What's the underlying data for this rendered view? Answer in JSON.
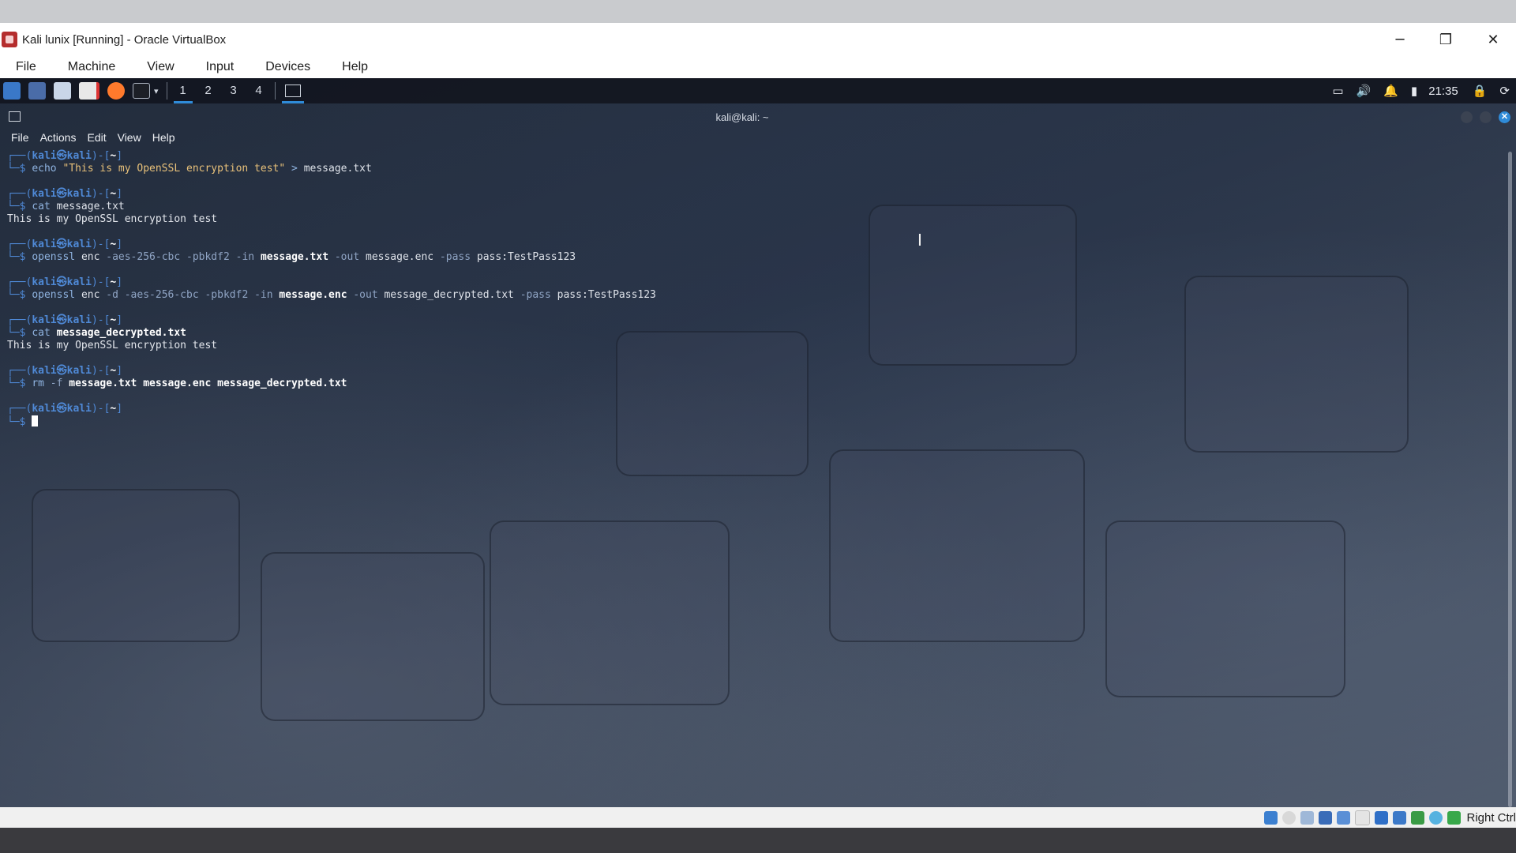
{
  "vbox": {
    "title": "Kali lunix [Running] - Oracle VirtualBox",
    "menu": [
      "File",
      "Machine",
      "View",
      "Input",
      "Devices",
      "Help"
    ],
    "controls": {
      "minimize": "─",
      "restore": "❐",
      "close": "✕"
    },
    "host_key": "Right Ctrl"
  },
  "panel": {
    "workspaces": [
      "1",
      "2",
      "3",
      "4"
    ],
    "active_workspace": "1",
    "clock": "21:35"
  },
  "terminal": {
    "title": "kali@kali: ~",
    "menu": [
      "File",
      "Actions",
      "Edit",
      "View",
      "Help"
    ],
    "prompt": {
      "top_prefix": "┌──(",
      "user": "kali㉿kali",
      "mid": ")-[",
      "dir": "~",
      "end": "]",
      "bottom": "└─$"
    },
    "blocks": [
      {
        "tokens": [
          {
            "t": "echo",
            "c": "cmd"
          },
          {
            "t": "\"This is my OpenSSL encryption test\"",
            "c": "str"
          },
          {
            "t": ">",
            "c": "cmd"
          },
          {
            "t": "message.txt",
            "c": "arg"
          }
        ],
        "output": []
      },
      {
        "tokens": [
          {
            "t": "cat",
            "c": "cmd"
          },
          {
            "t": "message.txt",
            "c": "arg"
          }
        ],
        "output": [
          "This is my OpenSSL encryption test"
        ]
      },
      {
        "tokens": [
          {
            "t": "openssl",
            "c": "cmd"
          },
          {
            "t": "enc",
            "c": "arg"
          },
          {
            "t": "-aes-256-cbc",
            "c": "opt"
          },
          {
            "t": "-pbkdf2",
            "c": "opt"
          },
          {
            "t": "-in",
            "c": "opt"
          },
          {
            "t": "message.txt",
            "c": "argb"
          },
          {
            "t": "-out",
            "c": "opt"
          },
          {
            "t": "message.enc",
            "c": "arg"
          },
          {
            "t": "-pass",
            "c": "opt"
          },
          {
            "t": "pass:TestPass123",
            "c": "arg"
          }
        ],
        "output": []
      },
      {
        "tokens": [
          {
            "t": "openssl",
            "c": "cmd"
          },
          {
            "t": "enc",
            "c": "arg"
          },
          {
            "t": "-d",
            "c": "opt"
          },
          {
            "t": "-aes-256-cbc",
            "c": "opt"
          },
          {
            "t": "-pbkdf2",
            "c": "opt"
          },
          {
            "t": "-in",
            "c": "opt"
          },
          {
            "t": "message.enc",
            "c": "argb"
          },
          {
            "t": "-out",
            "c": "opt"
          },
          {
            "t": "message_decrypted.txt",
            "c": "arg"
          },
          {
            "t": "-pass",
            "c": "opt"
          },
          {
            "t": "pass:TestPass123",
            "c": "arg"
          }
        ],
        "output": []
      },
      {
        "tokens": [
          {
            "t": "cat",
            "c": "cmd"
          },
          {
            "t": "message_decrypted.txt",
            "c": "argb"
          }
        ],
        "output": [
          "This is my OpenSSL encryption test"
        ]
      },
      {
        "tokens": [
          {
            "t": "rm",
            "c": "cmd"
          },
          {
            "t": "-f",
            "c": "opt"
          },
          {
            "t": "message.txt",
            "c": "argb"
          },
          {
            "t": "message.enc",
            "c": "argb"
          },
          {
            "t": "message_decrypted.txt",
            "c": "argb"
          }
        ],
        "output": []
      }
    ]
  },
  "colors": {
    "prompt_blue": "#4f89d6",
    "accent": "#2f8bd8",
    "vbox_icon": "#b52d2d"
  },
  "icons": {
    "panel_left": [
      "kali-menu-icon",
      "desktop-icon",
      "file-manager-icon",
      "text-editor-icon",
      "firefox-icon",
      "terminal-dropdown-icon"
    ],
    "panel_right": [
      "display-icon",
      "volume-icon",
      "notification-bell-icon",
      "battery-icon",
      "lock-icon",
      "power-icon"
    ],
    "status": [
      "disk-icon",
      "optical-icon",
      "audio-icon",
      "network-icon",
      "usb-icon",
      "shared-folder-icon",
      "display-icon",
      "capture-icon",
      "mouse-integration-icon",
      "recording-icon",
      "keyboard-icon"
    ]
  }
}
